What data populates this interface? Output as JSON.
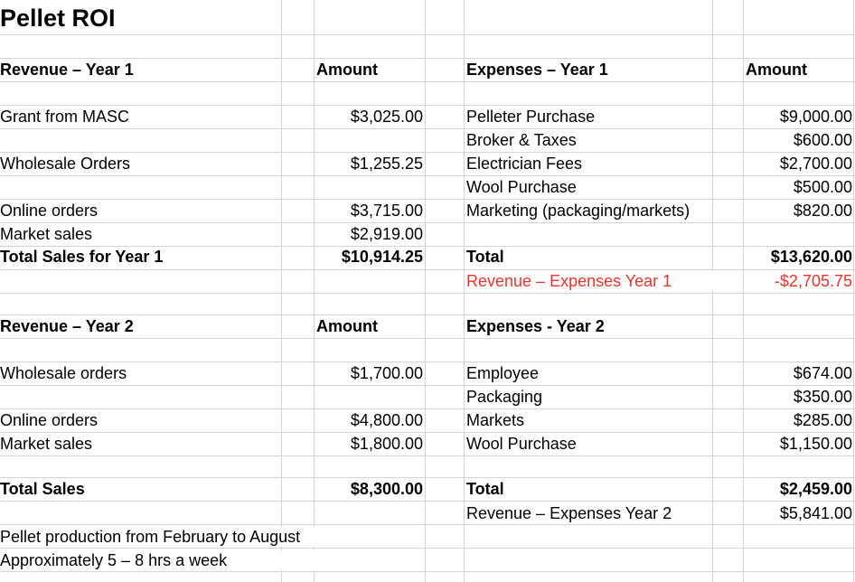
{
  "title": "Pellet ROI",
  "year1": {
    "revenue_header": "Revenue – Year 1",
    "amount_header": "Amount",
    "expenses_header": "Expenses – Year 1",
    "expenses_amount_header": "Amount",
    "revenue_items": [
      {
        "label": "Grant from MASC",
        "amount": "$3,025.00"
      },
      {
        "label": "Wholesale Orders",
        "amount": "$1,255.25"
      },
      {
        "label": "Online orders",
        "amount": "$3,715.00"
      },
      {
        "label": "Market sales",
        "amount": "$2,919.00"
      }
    ],
    "total_label": "Total Sales for Year 1",
    "total_amount": "$10,914.25",
    "expense_items": [
      {
        "label": "Pelleter Purchase",
        "amount": "$9,000.00"
      },
      {
        "label": "Broker & Taxes",
        "amount": "$600.00"
      },
      {
        "label": "Electrician Fees",
        "amount": "$2,700.00"
      },
      {
        "label": "Wool Purchase",
        "amount": "$500.00"
      },
      {
        "label": "Marketing (packaging/markets)",
        "amount": "$820.00"
      }
    ],
    "expense_total_label": "Total",
    "expense_total_amount": "$13,620.00",
    "net_label": "Revenue – Expenses Year 1",
    "net_amount": "-$2,705.75"
  },
  "year2": {
    "revenue_header": "Revenue – Year 2",
    "amount_header": "Amount",
    "expenses_header": "Expenses -  Year 2",
    "revenue_items": [
      {
        "label": "Wholesale orders",
        "amount": "$1,700.00"
      },
      {
        "label": "Online orders",
        "amount": "$4,800.00"
      },
      {
        "label": "Market sales",
        "amount": "$1,800.00"
      }
    ],
    "total_label": "Total Sales",
    "total_amount": "$8,300.00",
    "expense_items": [
      {
        "label": "Employee",
        "amount": "$674.00"
      },
      {
        "label": "Packaging",
        "amount": "$350.00"
      },
      {
        "label": "Markets",
        "amount": "$285.00"
      },
      {
        "label": "Wool Purchase",
        "amount": "$1,150.00"
      }
    ],
    "expense_total_label": "Total",
    "expense_total_amount": "$2,459.00",
    "net_label": "Revenue – Expenses Year 2",
    "net_amount": "$5,841.00"
  },
  "notes": [
    "Pellet production from February to August",
    "Approximately 5 – 8 hrs a week"
  ],
  "colors": {
    "negative": "#e8332f",
    "gridline": "#d4d4d4"
  }
}
